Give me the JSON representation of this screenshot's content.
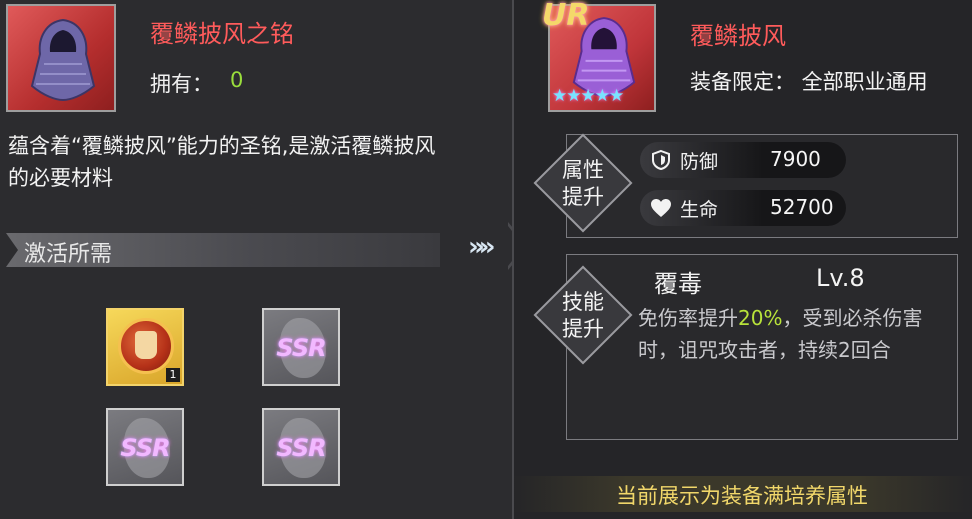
{
  "left": {
    "item_name": "覆鳞披风之铭",
    "own_label": "拥有：",
    "own_value": "0",
    "description": "蕴含着“覆鳞披风”能力的圣铭,是激活覆鳞披风的必要材料",
    "requirements_title": "激活所需",
    "slots": [
      {
        "type": "material",
        "count": "1"
      },
      {
        "type": "SSR",
        "label": "SSR"
      },
      {
        "type": "SSR",
        "label": "SSR"
      },
      {
        "type": "SSR",
        "label": "SSR"
      }
    ]
  },
  "arrows": "»»",
  "right": {
    "rarity_badge": "UR",
    "stars": "★★★★★",
    "equip_name": "覆鳞披风",
    "equip_limit": "装备限定： 全部职业通用",
    "attr_label_line1": "属性",
    "attr_label_line2": "提升",
    "stats": [
      {
        "icon": "shield-icon",
        "name": "防御",
        "value": "7900"
      },
      {
        "icon": "heart-icon",
        "name": "生命",
        "value": "52700"
      }
    ],
    "skill_label_line1": "技能",
    "skill_label_line2": "提升",
    "skill": {
      "name": "覆毒",
      "level": "Lv.8",
      "desc_prefix": "免伤率提升",
      "desc_highlight": "20%",
      "desc_suffix": "，受到必杀伤害时，诅咒攻击者，持续2回合"
    },
    "footer": "当前展示为装备满培养属性"
  },
  "colors": {
    "name_red": "#ff5b5b",
    "own_green": "#9ade3c",
    "highlight_green": "#b8e23a",
    "footer_gold": "#f1d76a"
  }
}
